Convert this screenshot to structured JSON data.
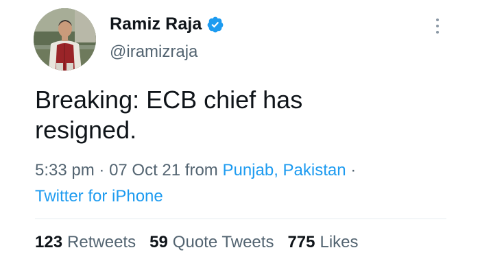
{
  "author": {
    "display_name": "Ramiz Raja",
    "handle": "@iramizraja",
    "verified_icon": "verified-badge-icon",
    "avatar": "profile-photo"
  },
  "tweet": {
    "text": "Breaking: ECB chief has resigned.",
    "time": "5:33 pm",
    "sep1": "·",
    "date": "07 Oct 21",
    "from_label": "from",
    "location": "Punjab, Pakistan",
    "sep2": "·",
    "source": "Twitter for iPhone"
  },
  "stats": {
    "retweets_count": "123",
    "retweets_label": "Retweets",
    "quotes_count": "59",
    "quotes_label": "Quote Tweets",
    "likes_count": "775",
    "likes_label": "Likes"
  },
  "colors": {
    "link": "#1d9bf0",
    "verified": "#1d9bf0",
    "secondary_text": "#536471",
    "primary_text": "#0f1419"
  },
  "icons": {
    "more": "more-vertical-icon"
  }
}
